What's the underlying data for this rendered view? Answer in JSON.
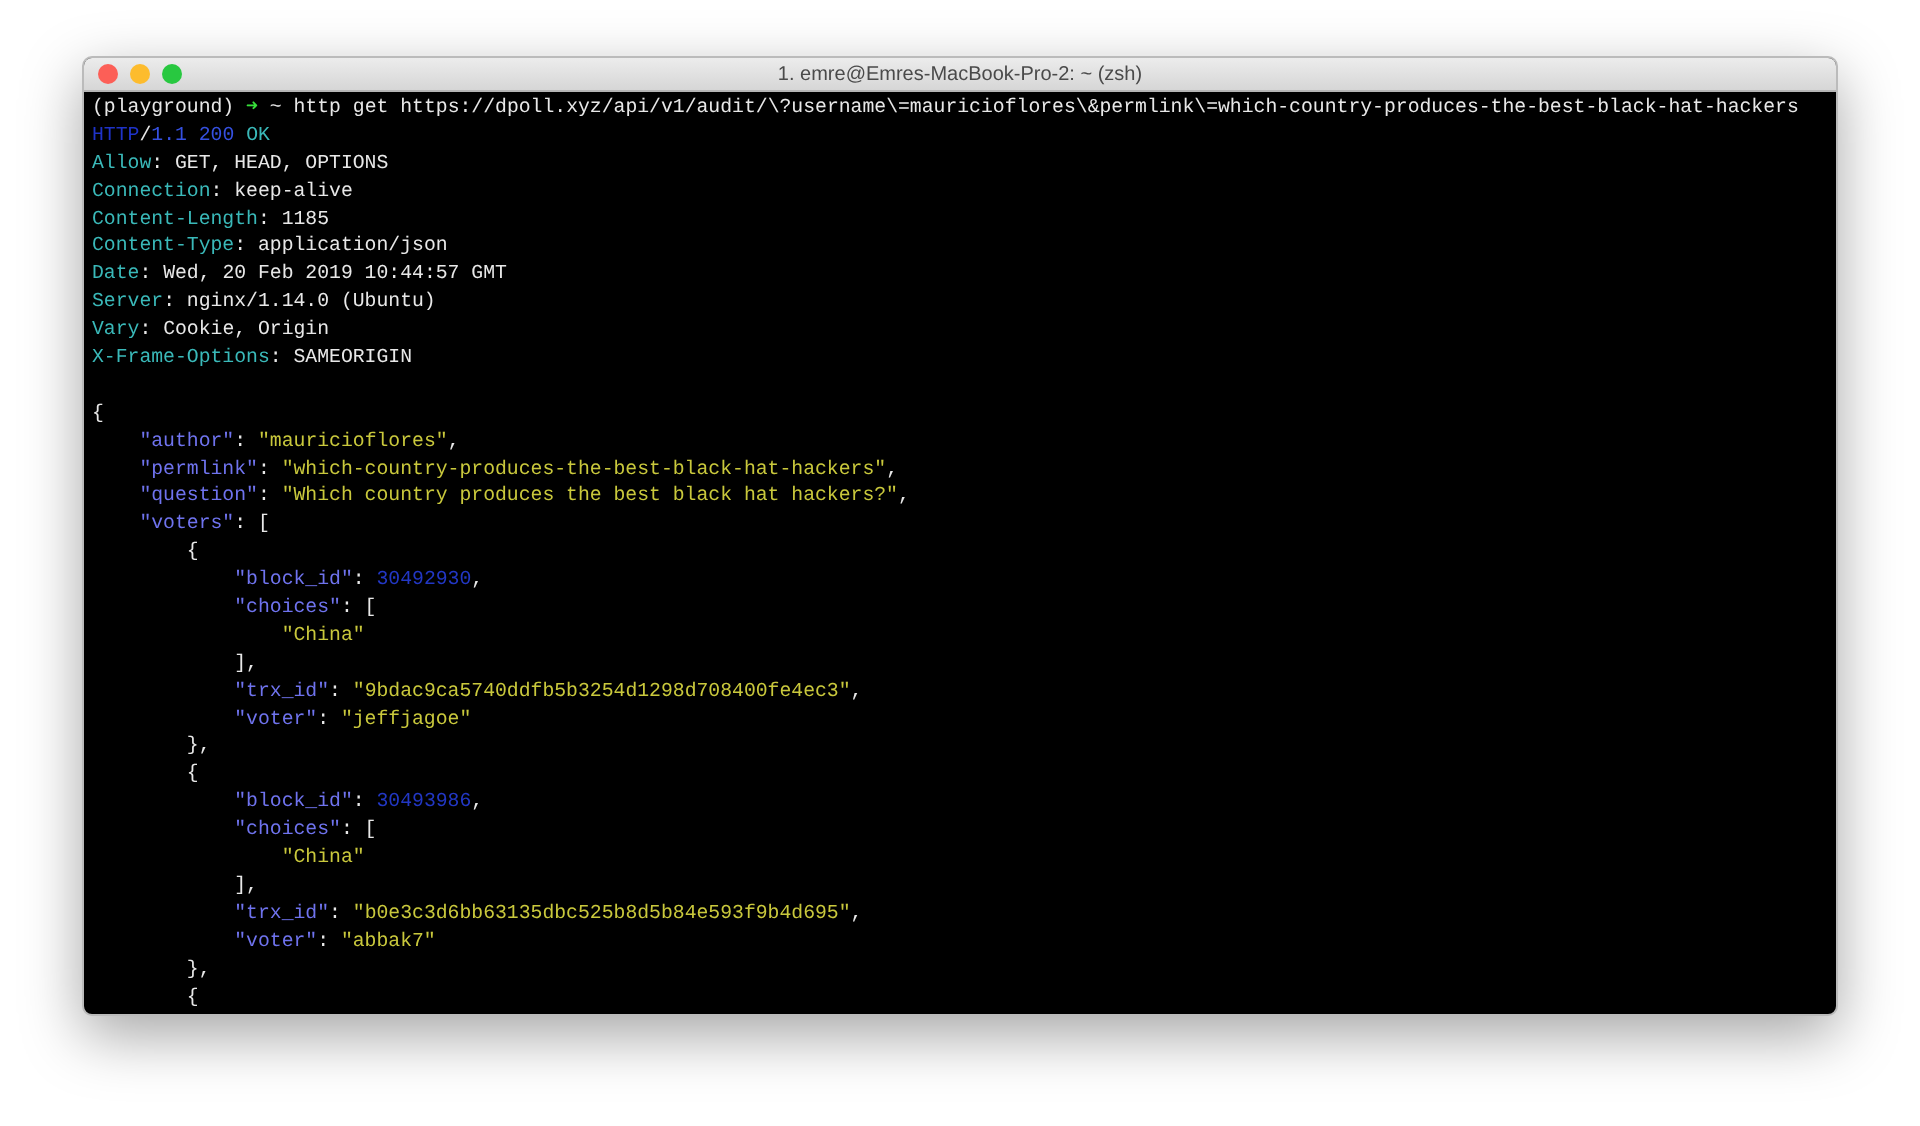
{
  "window": {
    "title": "1. emre@Emres-MacBook-Pro-2: ~ (zsh)"
  },
  "terminal": {
    "lines": [
      {
        "kind": "text",
        "segments": [
          {
            "kind": "plain",
            "text": "(playground) "
          },
          {
            "kind": "prompt",
            "text": "➜"
          },
          {
            "kind": "plain",
            "text": " ~ http get https://dpoll.xyz/api/v1/audit/\\?username\\=mauricioflores\\&permlink\\=which-country-produces-the-best-black-hat-hackers"
          }
        ]
      },
      {
        "kind": "text",
        "segments": [
          {
            "kind": "protocol",
            "text": "HTTP"
          },
          {
            "kind": "plain",
            "text": "/"
          },
          {
            "kind": "version",
            "text": "1.1 200"
          },
          {
            "kind": "header",
            "text": " OK"
          }
        ]
      },
      {
        "kind": "text",
        "segments": [
          {
            "kind": "header",
            "text": "Allow"
          },
          {
            "kind": "plain",
            "text": ": GET, HEAD, OPTIONS"
          }
        ]
      },
      {
        "kind": "text",
        "segments": [
          {
            "kind": "header",
            "text": "Connection"
          },
          {
            "kind": "plain",
            "text": ": keep-alive"
          }
        ]
      },
      {
        "kind": "text",
        "segments": [
          {
            "kind": "header",
            "text": "Content-Length"
          },
          {
            "kind": "plain",
            "text": ": 1185"
          }
        ]
      },
      {
        "kind": "text",
        "segments": [
          {
            "kind": "header",
            "text": "Content-Type"
          },
          {
            "kind": "plain",
            "text": ": application/json"
          }
        ]
      },
      {
        "kind": "text",
        "segments": [
          {
            "kind": "header",
            "text": "Date"
          },
          {
            "kind": "plain",
            "text": ": Wed, 20 Feb 2019 10:44:57 GMT"
          }
        ]
      },
      {
        "kind": "text",
        "segments": [
          {
            "kind": "header",
            "text": "Server"
          },
          {
            "kind": "plain",
            "text": ": nginx/1.14.0 (Ubuntu)"
          }
        ]
      },
      {
        "kind": "text",
        "segments": [
          {
            "kind": "header",
            "text": "Vary"
          },
          {
            "kind": "plain",
            "text": ": Cookie, Origin"
          }
        ]
      },
      {
        "kind": "text",
        "segments": [
          {
            "kind": "header",
            "text": "X-Frame-Options"
          },
          {
            "kind": "plain",
            "text": ": SAMEORIGIN"
          }
        ]
      },
      {
        "kind": "blank"
      },
      {
        "kind": "text",
        "segments": [
          {
            "kind": "plain",
            "text": "{"
          }
        ]
      },
      {
        "kind": "text",
        "segments": [
          {
            "kind": "key",
            "text": "    \"author\""
          },
          {
            "kind": "plain",
            "text": ": "
          },
          {
            "kind": "string",
            "text": "\"mauricioflores\""
          },
          {
            "kind": "plain",
            "text": ","
          }
        ]
      },
      {
        "kind": "text",
        "segments": [
          {
            "kind": "key",
            "text": "    \"permlink\""
          },
          {
            "kind": "plain",
            "text": ": "
          },
          {
            "kind": "string",
            "text": "\"which-country-produces-the-best-black-hat-hackers\""
          },
          {
            "kind": "plain",
            "text": ","
          }
        ]
      },
      {
        "kind": "text",
        "segments": [
          {
            "kind": "key",
            "text": "    \"question\""
          },
          {
            "kind": "plain",
            "text": ": "
          },
          {
            "kind": "string",
            "text": "\"Which country produces the best black hat hackers?\""
          },
          {
            "kind": "plain",
            "text": ","
          }
        ]
      },
      {
        "kind": "text",
        "segments": [
          {
            "kind": "key",
            "text": "    \"voters\""
          },
          {
            "kind": "plain",
            "text": ": ["
          }
        ]
      },
      {
        "kind": "text",
        "segments": [
          {
            "kind": "plain",
            "text": "        {"
          }
        ]
      },
      {
        "kind": "text",
        "segments": [
          {
            "kind": "key",
            "text": "            \"block_id\""
          },
          {
            "kind": "plain",
            "text": ": "
          },
          {
            "kind": "number",
            "text": "30492930"
          },
          {
            "kind": "plain",
            "text": ","
          }
        ]
      },
      {
        "kind": "text",
        "segments": [
          {
            "kind": "key",
            "text": "            \"choices\""
          },
          {
            "kind": "plain",
            "text": ": ["
          }
        ]
      },
      {
        "kind": "text",
        "segments": [
          {
            "kind": "string",
            "text": "                \"China\""
          }
        ]
      },
      {
        "kind": "text",
        "segments": [
          {
            "kind": "plain",
            "text": "            ],"
          }
        ]
      },
      {
        "kind": "text",
        "segments": [
          {
            "kind": "key",
            "text": "            \"trx_id\""
          },
          {
            "kind": "plain",
            "text": ": "
          },
          {
            "kind": "string",
            "text": "\"9bdac9ca5740ddfb5b3254d1298d708400fe4ec3\""
          },
          {
            "kind": "plain",
            "text": ","
          }
        ]
      },
      {
        "kind": "text",
        "segments": [
          {
            "kind": "key",
            "text": "            \"voter\""
          },
          {
            "kind": "plain",
            "text": ": "
          },
          {
            "kind": "string",
            "text": "\"jeffjagoe\""
          }
        ]
      },
      {
        "kind": "text",
        "segments": [
          {
            "kind": "plain",
            "text": "        },"
          }
        ]
      },
      {
        "kind": "text",
        "segments": [
          {
            "kind": "plain",
            "text": "        {"
          }
        ]
      },
      {
        "kind": "text",
        "segments": [
          {
            "kind": "key",
            "text": "            \"block_id\""
          },
          {
            "kind": "plain",
            "text": ": "
          },
          {
            "kind": "number",
            "text": "30493986"
          },
          {
            "kind": "plain",
            "text": ","
          }
        ]
      },
      {
        "kind": "text",
        "segments": [
          {
            "kind": "key",
            "text": "            \"choices\""
          },
          {
            "kind": "plain",
            "text": ": ["
          }
        ]
      },
      {
        "kind": "text",
        "segments": [
          {
            "kind": "string",
            "text": "                \"China\""
          }
        ]
      },
      {
        "kind": "text",
        "segments": [
          {
            "kind": "plain",
            "text": "            ],"
          }
        ]
      },
      {
        "kind": "text",
        "segments": [
          {
            "kind": "key",
            "text": "            \"trx_id\""
          },
          {
            "kind": "plain",
            "text": ": "
          },
          {
            "kind": "string",
            "text": "\"b0e3c3d6bb63135dbc525b8d5b84e593f9b4d695\""
          },
          {
            "kind": "plain",
            "text": ","
          }
        ]
      },
      {
        "kind": "text",
        "segments": [
          {
            "kind": "key",
            "text": "            \"voter\""
          },
          {
            "kind": "plain",
            "text": ": "
          },
          {
            "kind": "string",
            "text": "\"abbak7\""
          }
        ]
      },
      {
        "kind": "text",
        "segments": [
          {
            "kind": "plain",
            "text": "        },"
          }
        ]
      },
      {
        "kind": "text",
        "segments": [
          {
            "kind": "plain",
            "text": "        {"
          }
        ]
      }
    ]
  }
}
